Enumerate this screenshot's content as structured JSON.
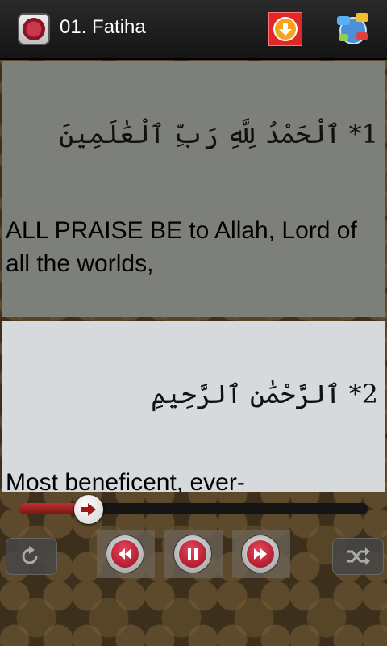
{
  "header": {
    "title": "01. Fatiha",
    "logo_icon": "quran-logo-icon",
    "download_icon": "download-icon",
    "share_icon": "share-chat-icon"
  },
  "verses": [
    {
      "arabic": "1* ٱلْحَمْدُ لِلَّهِ رَبِّ ٱلْعَٰلَمِينَ",
      "english": "ALL PRAISE BE to Allah, Lord of all the worlds,"
    },
    {
      "arabic": "2* ٱلرَّحْمَٰنِ ٱلرَّحِيمِ",
      "english": "Most beneficent, ever-"
    }
  ],
  "player": {
    "progress": 0.2,
    "repeat_icon": "repeat-icon",
    "rewind_icon": "rewind-icon",
    "pause_icon": "pause-icon",
    "fast_forward_icon": "fast-forward-icon",
    "shuffle_icon": "shuffle-icon",
    "accent": "#c03030"
  }
}
